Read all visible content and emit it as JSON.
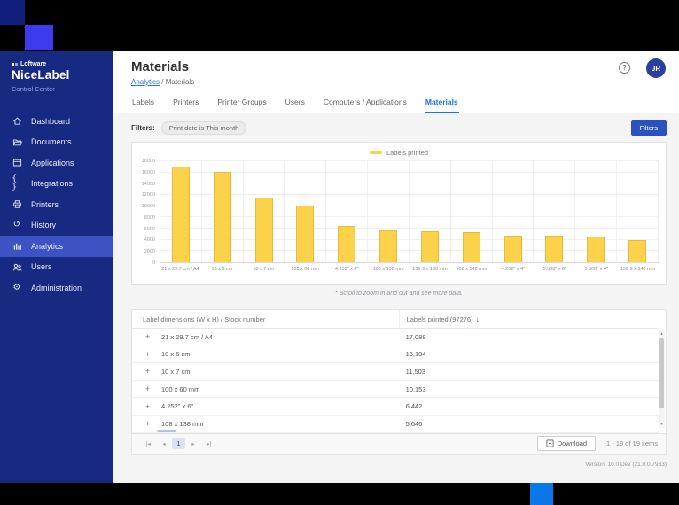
{
  "brand": {
    "company": "Loftware",
    "product": "NiceLabel",
    "suite": "Control Center"
  },
  "sidebar": {
    "items": [
      {
        "label": "Dashboard",
        "icon": "home-icon",
        "active": false
      },
      {
        "label": "Documents",
        "icon": "folder-icon",
        "active": false
      },
      {
        "label": "Applications",
        "icon": "window-icon",
        "active": false
      },
      {
        "label": "Integrations",
        "icon": "braces-icon",
        "active": false
      },
      {
        "label": "Printers",
        "icon": "printer-icon",
        "active": false
      },
      {
        "label": "History",
        "icon": "history-icon",
        "active": false
      },
      {
        "label": "Analytics",
        "icon": "analytics-icon",
        "active": true
      },
      {
        "label": "Users",
        "icon": "users-icon",
        "active": false
      },
      {
        "label": "Administration",
        "icon": "gear-icon",
        "active": false
      }
    ]
  },
  "header": {
    "title": "Materials",
    "breadcrumb_link": "Analytics",
    "breadcrumb_sep": "/",
    "breadcrumb_current": "Materials",
    "help": "?",
    "avatar": "JR"
  },
  "tabs": [
    {
      "label": "Labels",
      "active": false
    },
    {
      "label": "Printers",
      "active": false
    },
    {
      "label": "Printer Groups",
      "active": false
    },
    {
      "label": "Users",
      "active": false
    },
    {
      "label": "Computers / Applications",
      "active": false
    },
    {
      "label": "Materials",
      "active": true
    }
  ],
  "filters": {
    "label": "Filters:",
    "chip": "Print date is This month",
    "button": "Filters"
  },
  "chart_data": {
    "type": "bar",
    "title": "",
    "legend": [
      "Labels printed"
    ],
    "legend_position": "top",
    "categories": [
      "21 x 29.7 cm / A4",
      "10 x 6 cm",
      "10 x 7 cm",
      "100 x 60 mm",
      "4.252\" x 6\"",
      "108 x 138 mm",
      "139.9 x 138 mm",
      "108 x 148 mm",
      "4.252\" x 4\"",
      "5.508\" x 6\"",
      "5.508\" x 4\"",
      "139.9 x 148 mm"
    ],
    "values": [
      17088,
      16104,
      11503,
      10153,
      6442,
      5646,
      5550,
      5340,
      4740,
      4700,
      4650,
      3900
    ],
    "ylim": [
      0,
      18000
    ],
    "ytick_step": 2000,
    "grid": true,
    "bar_color": "#FDD24B",
    "note": "* Scroll to zoom in and out and see more data."
  },
  "table": {
    "columns": [
      "Label dimensions (W x H) / Stock number",
      "Labels printed (97276)"
    ],
    "sort_icon": "↓",
    "expander": "+",
    "rows": [
      {
        "dims": "21 x 29.7 cm / A4",
        "printed": "17,088"
      },
      {
        "dims": "10 x 6 cm",
        "printed": "16,104"
      },
      {
        "dims": "10 x 7 cm",
        "printed": "11,503"
      },
      {
        "dims": "100 x 60 mm",
        "printed": "10,153"
      },
      {
        "dims": "4.252\" x 6\"",
        "printed": "6,442"
      },
      {
        "dims": "108 x 138 mm",
        "printed": "5,646"
      }
    ]
  },
  "pagination": {
    "page": "1",
    "download": "Download",
    "range": "1 - 19 of 19 items"
  },
  "footer": {
    "version": "Version: 10.0 Dev (21.0.0.7963)"
  },
  "colors": {
    "accent_blue": "#1A73E8",
    "button_blue": "#2A52BF",
    "sidebar_navy": "#182982",
    "selected_blue": "#3D53C4",
    "bar_yellow": "#FDD24B",
    "deco_navy": "#111E7B",
    "deco_violet": "#3C3BEE",
    "deco_azure": "#0B76E8"
  }
}
